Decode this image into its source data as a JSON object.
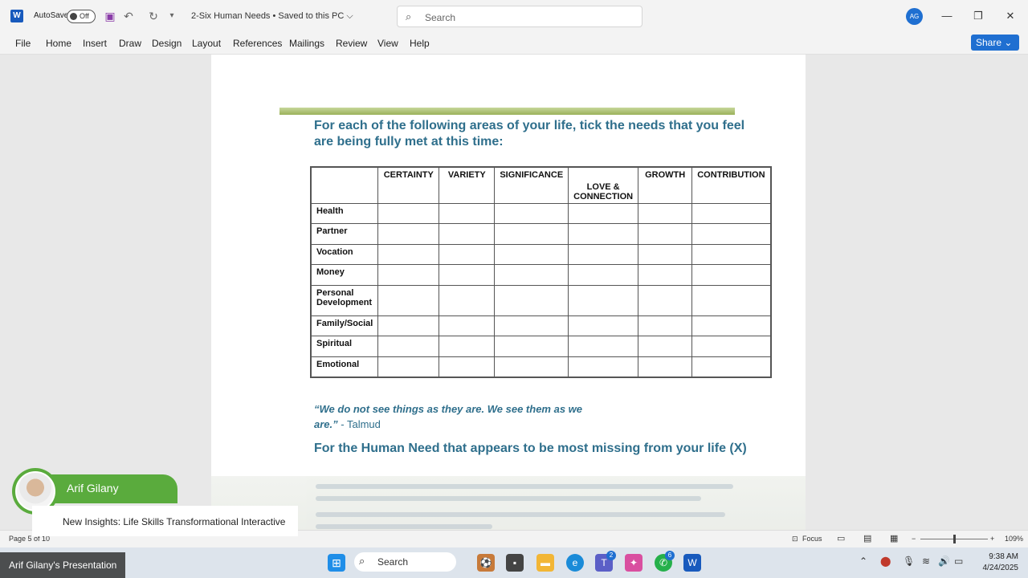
{
  "titlebar": {
    "autosave_label": "AutoSave",
    "autosave_state": "Off",
    "doc_title": "2-Six Human Needs • Saved to this PC ⌵",
    "search_placeholder": "Search",
    "avatar_initials": "AG"
  },
  "menu": [
    "File",
    "Home",
    "Insert",
    "Draw",
    "Design",
    "Layout",
    "References",
    "Mailings",
    "Review",
    "View",
    "Help"
  ],
  "share_label": "Share ⌄",
  "document": {
    "heading": "For each of the following areas of your life, tick the needs that you feel are being fully met at this time:",
    "table": {
      "columns": [
        "",
        "CERTAINTY",
        "VARIETY",
        "SIGNIFICANCE",
        "LOVE & CONNECTION",
        "GROWTH",
        "CONTRIBUTION"
      ],
      "rows": [
        "Health",
        "Partner",
        "Vocation",
        "Money",
        "Personal Development",
        "Family/Social",
        "Spiritual",
        "Emotional"
      ]
    },
    "quote": "“We do not see things as they are. We see them as we are.”",
    "quote_author": "- Talmud",
    "heading2": "For the Human Need that appears to be most missing from your life (X)"
  },
  "statusbar": {
    "page": "Page 5 of 10",
    "focus": "Focus",
    "zoom": "109%"
  },
  "presenter": {
    "name": "Arif Gilany",
    "subtitle": "New Insights: Life Skills Transformational Interactive"
  },
  "taskbar": {
    "caption": "Arif Gilany's Presentation",
    "search_label": "Search",
    "teams_badge": "2",
    "whatsapp_badge": "6",
    "time": "9:38 AM",
    "date": "4/24/2025"
  },
  "colors": {
    "accent": "#1f6fd1",
    "heading_teal": "#2f6f8c",
    "presenter_green": "#5aab3d",
    "word_blue": "#185abd"
  }
}
